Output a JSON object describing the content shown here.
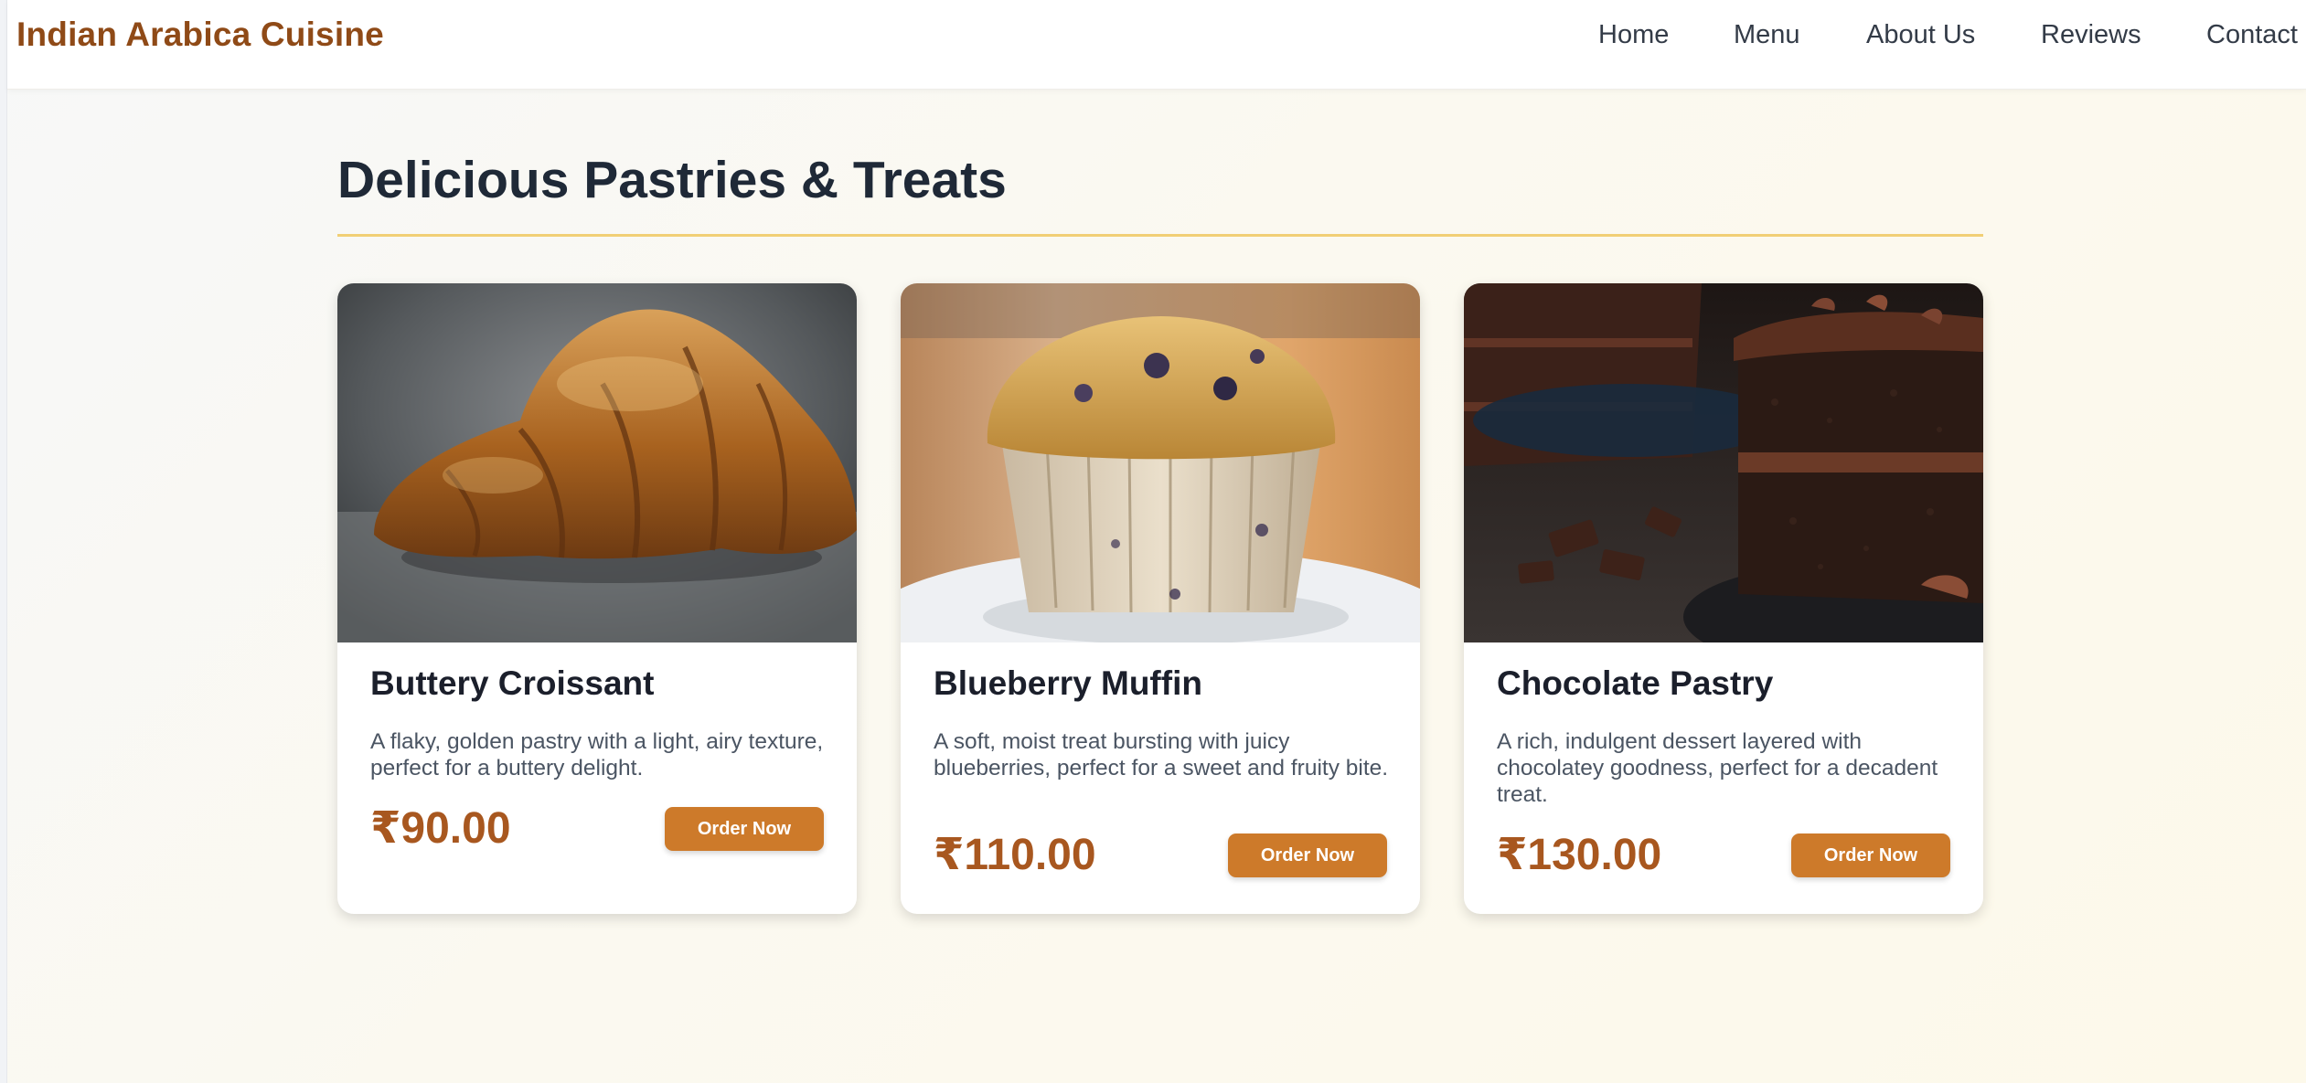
{
  "header": {
    "brand": "Indian Arabica Cuisine",
    "nav": [
      {
        "label": "Home"
      },
      {
        "label": "Menu"
      },
      {
        "label": "About Us"
      },
      {
        "label": "Reviews"
      },
      {
        "label": "Contact"
      }
    ]
  },
  "main": {
    "section_title": "Delicious Pastries & Treats",
    "items": [
      {
        "name": "Buttery Croissant",
        "description": "A flaky, golden pastry with a light, airy texture, perfect for a buttery delight.",
        "price": "₹90.00",
        "button_label": "Order Now",
        "image": "croissant-photo"
      },
      {
        "name": "Blueberry Muffin",
        "description": "A soft, moist treat bursting with juicy blueberries, perfect for a sweet and fruity bite.",
        "price": "₹110.00",
        "button_label": "Order Now",
        "image": "blueberry-muffin-photo"
      },
      {
        "name": "Chocolate Pastry",
        "description": "A rich, indulgent dessert layered with chocolatey goodness, perfect for a decadent treat.",
        "price": "₹130.00",
        "button_label": "Order Now",
        "image": "chocolate-cake-photo"
      }
    ]
  },
  "colors": {
    "brand": "#8f4a17",
    "accent_rule": "#f1cf75",
    "button": "#cd7a2a",
    "price": "#a8571f"
  }
}
